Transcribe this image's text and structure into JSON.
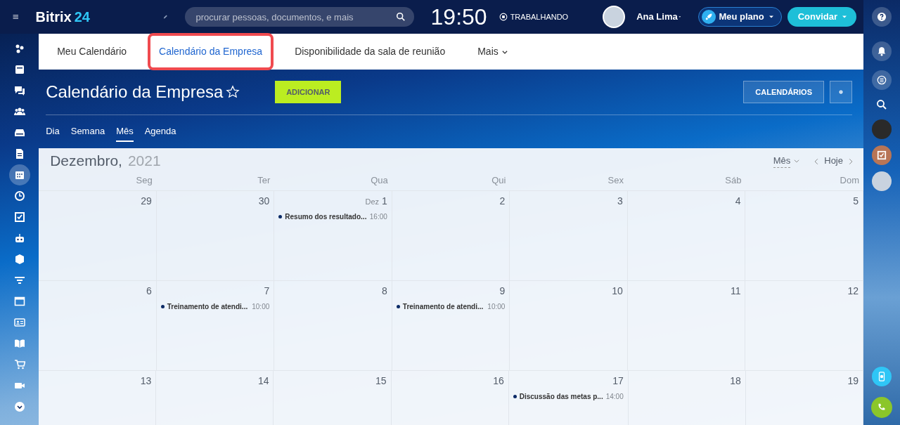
{
  "top_bar": {
    "logo_name": "Bitrix",
    "logo_number": "24",
    "search": {
      "placeholder": "procurar pessoas, documentos, e mais"
    },
    "clock": "19:50",
    "work_status": "TRABALHANDO",
    "user_name": "Ana Lima",
    "plan_button": "Meu plano",
    "invite_button": "Convidar"
  },
  "left_sidebar": {
    "items": [
      {
        "selected": false
      },
      {
        "selected": false
      },
      {
        "selected": false
      },
      {
        "selected": false
      },
      {
        "selected": false
      },
      {
        "selected": false
      },
      {
        "selected": true
      },
      {
        "selected": false
      },
      {
        "selected": false
      },
      {
        "selected": false
      },
      {
        "selected": false
      },
      {
        "selected": false
      },
      {
        "selected": false
      },
      {
        "selected": false
      },
      {
        "selected": false
      },
      {
        "selected": false
      },
      {
        "selected": false
      },
      {
        "selected": false
      }
    ]
  },
  "tabs": [
    {
      "label": "Meu Calendário",
      "selected": false,
      "highlighted": false
    },
    {
      "label": "Calendário da Empresa",
      "selected": true,
      "highlighted": true
    },
    {
      "label": "Disponibilidade da sala de reunião",
      "selected": false,
      "highlighted": false
    },
    {
      "label": "Mais",
      "selected": false,
      "highlighted": false
    }
  ],
  "header": {
    "title": "Calendário da Empresa",
    "add_button": "ADICIONAR",
    "calendars_button": "CALENDÁRIOS"
  },
  "view_tabs": [
    {
      "label": "Dia",
      "selected": false
    },
    {
      "label": "Semana",
      "selected": false
    },
    {
      "label": "Mês",
      "selected": true
    },
    {
      "label": "Agenda",
      "selected": false
    }
  ],
  "calendar": {
    "month": "Dezembro,",
    "year": "2021",
    "view_select": "Mês",
    "today_button": "Hoje",
    "weekdays": [
      "Seg",
      "Ter",
      "Qua",
      "Qui",
      "Sex",
      "Sáb",
      "Dom"
    ],
    "weeks": [
      [
        {
          "day": "29"
        },
        {
          "day": "30"
        },
        {
          "month_label": "Dez",
          "day": "1",
          "events": [
            {
              "title": "Resumo dos resultado...",
              "time": "16:00"
            }
          ]
        },
        {
          "day": "2"
        },
        {
          "day": "3"
        },
        {
          "day": "4"
        },
        {
          "day": "5"
        }
      ],
      [
        {
          "day": "6"
        },
        {
          "day": "7",
          "events": [
            {
              "title": "Treinamento de atendi...",
              "time": "10:00"
            }
          ]
        },
        {
          "day": "8"
        },
        {
          "day": "9",
          "events": [
            {
              "title": "Treinamento de atendi...",
              "time": "10:00"
            }
          ]
        },
        {
          "day": "10"
        },
        {
          "day": "11"
        },
        {
          "day": "12"
        }
      ],
      [
        {
          "day": "13"
        },
        {
          "day": "14"
        },
        {
          "day": "15"
        },
        {
          "day": "16"
        },
        {
          "day": "17",
          "events": [
            {
              "title": "Discussão das metas p...",
              "time": "14:00"
            }
          ]
        },
        {
          "day": "18"
        },
        {
          "day": "19"
        }
      ]
    ]
  }
}
